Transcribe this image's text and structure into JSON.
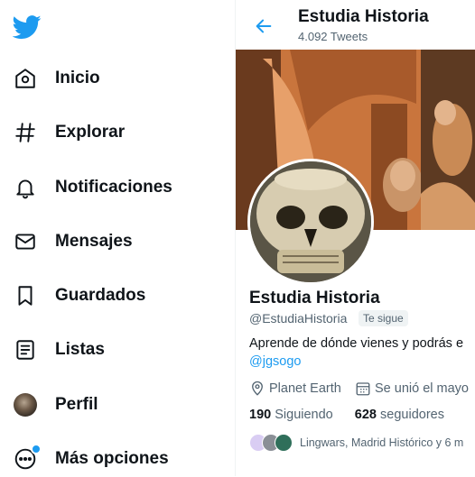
{
  "colors": {
    "accent": "#1d9bf0",
    "text": "#0f1419",
    "muted": "#536471"
  },
  "sidebar": {
    "logo_icon": "twitter-bird-icon",
    "items": [
      {
        "label": "Inicio",
        "icon": "home-icon"
      },
      {
        "label": "Explorar",
        "icon": "hashtag-icon"
      },
      {
        "label": "Notificaciones",
        "icon": "bell-icon"
      },
      {
        "label": "Mensajes",
        "icon": "envelope-icon"
      },
      {
        "label": "Guardados",
        "icon": "bookmark-icon"
      },
      {
        "label": "Listas",
        "icon": "list-icon"
      },
      {
        "label": "Perfil",
        "icon": "avatar"
      },
      {
        "label": "Más opciones",
        "icon": "more-circle-icon"
      }
    ]
  },
  "header": {
    "title": "Estudia Historia",
    "tweet_count": "4.092 Tweets"
  },
  "profile": {
    "name": "Estudia Historia",
    "handle": "@EstudiaHistoria",
    "follows_you": "Te sigue",
    "bio": "Aprende de dónde vienes y podrás e",
    "mention": "@jgsogo",
    "location": "Planet Earth",
    "joined": "Se unió el mayo",
    "following_count": "190",
    "following_label": "Siguiendo",
    "followers_count": "628",
    "followers_label": "seguidores",
    "known_followers": "Lingwars, Madrid Histórico y 6 m"
  }
}
